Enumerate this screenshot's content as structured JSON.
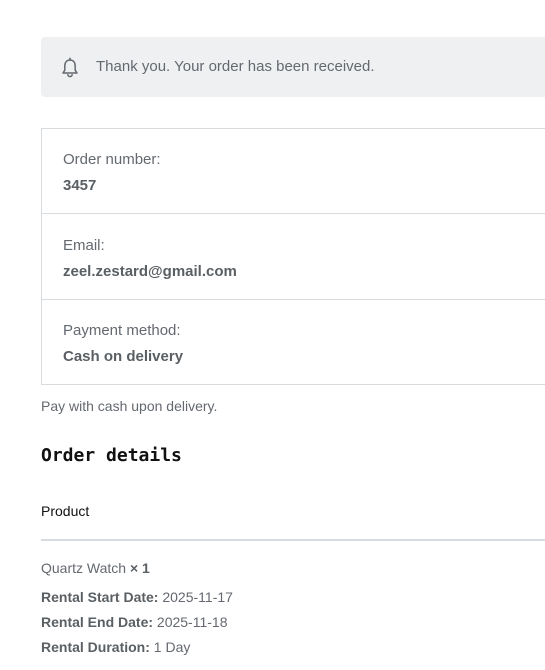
{
  "notice": {
    "icon": "bell-icon",
    "message": "Thank you. Your order has been received."
  },
  "overview": [
    {
      "label": "Order number:",
      "value": "3457"
    },
    {
      "label": "Email:",
      "value": "zeel.zestard@gmail.com"
    },
    {
      "label": "Payment method:",
      "value": "Cash on delivery"
    }
  ],
  "payment_note": "Pay with cash upon delivery.",
  "order_details": {
    "heading": "Order details",
    "column_header": "Product",
    "item": {
      "name": "Quartz Watch",
      "quantity": "× 1"
    },
    "meta": [
      {
        "key": "Rental Start Date:",
        "value": "2025-11-17"
      },
      {
        "key": "Rental End Date:",
        "value": "2025-11-18"
      },
      {
        "key": "Rental Duration:",
        "value": "1 Day"
      }
    ]
  }
}
